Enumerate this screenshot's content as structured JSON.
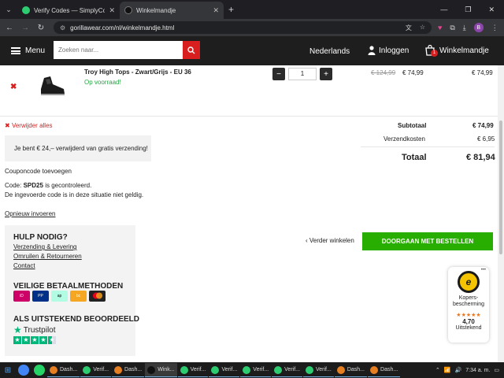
{
  "browser": {
    "tabs": [
      {
        "title": "Verify Codes — SimplyCodes",
        "active": false
      },
      {
        "title": "Winkelmandje",
        "active": true
      }
    ],
    "url": "gorillawear.com/nl/winkelmandje.html"
  },
  "header": {
    "menu_label": "Menu",
    "search_placeholder": "Zoeken naar...",
    "language": "Nederlands",
    "login": "Inloggen",
    "cart": "Winkelmandje",
    "cart_count": "1"
  },
  "cart": {
    "item": {
      "name": "Troy High Tops - Zwart/Grijs - EU 36",
      "stock": "Op voorraad!",
      "quantity": "1",
      "old_price": "€ 124,99",
      "price": "€ 74,99",
      "line_total": "€ 74,99"
    },
    "remove_all": "Verwijder alles",
    "free_shipping_notice": "Je bent € 24,– verwijderd van gratis verzending!",
    "coupon_heading": "Couponcode toevoegen",
    "coupon_code_label": "Code:",
    "coupon_code": "SPD25",
    "coupon_checked": "is gecontroleerd.",
    "coupon_invalid": "De ingevoerde code is in deze situatie niet geldig.",
    "reenter": "Opnieuw invoeren",
    "totals": {
      "subtotal_label": "Subtotaal",
      "subtotal": "€ 74,99",
      "shipping_label": "Verzendkosten",
      "shipping": "€ 6,95",
      "total_label": "Totaal",
      "total": "€ 81,94"
    },
    "continue_shopping": "Verder winkelen",
    "checkout": "DOORGAAN MET BESTELLEN"
  },
  "help": {
    "heading": "HULP NODIG?",
    "links": [
      "Verzending & Levering",
      "Omruilen & Retourneren",
      "Contact"
    ],
    "payments_heading": "VEILIGE BETAALMETHODEN",
    "rating_heading": "ALS UITSTEKEND BEOORDEELD",
    "trustpilot": "Trustpilot"
  },
  "trust_badge": {
    "line1": "Kopers-",
    "line2": "bescherming",
    "score": "4,70",
    "rating_word": "Uitstekend",
    "rating_fraction": 0.94
  },
  "taskbar": {
    "items": [
      "Dash...",
      "Verif...",
      "Dash...",
      "Wink...",
      "Verif...",
      "Verif...",
      "Verif...",
      "Verif...",
      "Verif...",
      "Dash...",
      "Dash..."
    ],
    "active_index": 3,
    "time": "7:34 a. m."
  }
}
